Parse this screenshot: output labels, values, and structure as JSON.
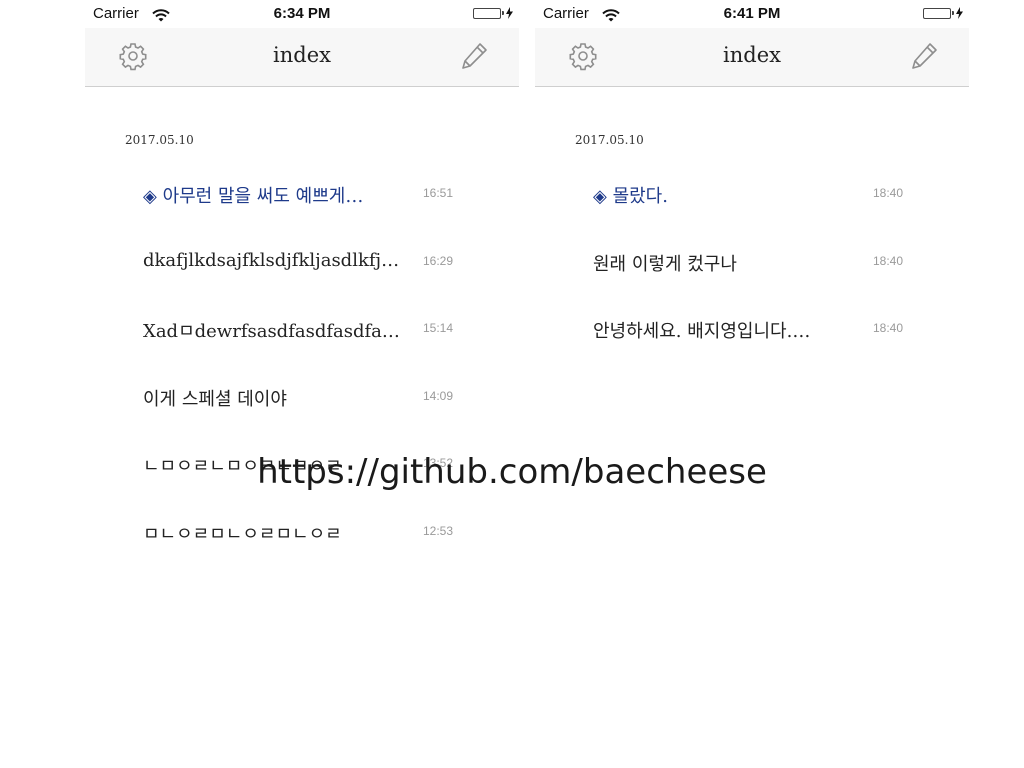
{
  "left": {
    "status": {
      "carrier": "Carrier",
      "time": "6:34 PM"
    },
    "nav": {
      "title": "index"
    },
    "date": "2017.05.10",
    "memos": [
      {
        "title": "◈ 아무런 말을 써도 예쁘게…",
        "time": "16:51",
        "selected": true
      },
      {
        "title": "dkafjlkdsajfklsdjfkljasdlkfjs…",
        "time": "16:29",
        "selected": false
      },
      {
        "title": "Xadㅁdewrfsasdfasdfasdfa…",
        "time": "15:14",
        "selected": false
      },
      {
        "title": "이게 스페셜 데이야",
        "time": "14:09",
        "selected": false
      },
      {
        "title": "ㄴㅁㅇㄹㄴㅁㅇㄹㄴㅁㅇㄹ",
        "time": "13:52",
        "selected": false
      },
      {
        "title": "ㅁㄴㅇㄹㅁㄴㅇㄹㅁㄴㅇㄹ",
        "time": "12:53",
        "selected": false
      }
    ]
  },
  "right": {
    "status": {
      "carrier": "Carrier",
      "time": "6:41 PM"
    },
    "nav": {
      "title": "index"
    },
    "date": "2017.05.10",
    "memos": [
      {
        "title": "◈ 몰랐다.",
        "time": "18:40",
        "selected": true
      },
      {
        "title": "원래 이렇게 컸구나",
        "time": "18:40",
        "selected": false
      },
      {
        "title": "안녕하세요. 배지영입니다.…",
        "time": "18:40",
        "selected": false
      }
    ]
  },
  "watermark": "https://github.com/baecheese",
  "colors": {
    "selected_text": "#1e3a8a",
    "battery": "#4cd964",
    "nav_bg": "#f7f7f7"
  },
  "icons": {
    "settings": "gear-icon",
    "edit": "pencil-icon",
    "wifi": "wifi-icon",
    "battery": "battery-icon"
  }
}
